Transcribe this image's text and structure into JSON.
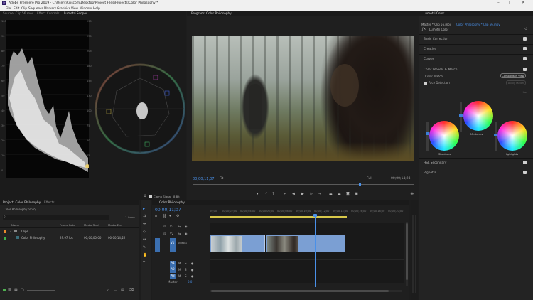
{
  "window": {
    "title": "Adobe Premiere Pro 2019 - C:\\Users\\Criscom\\Desktop\\Project Files\\Projects\\Color Philosophy *",
    "controls": [
      "–",
      "□",
      "✕"
    ]
  },
  "menu": [
    "File",
    "Edit",
    "Clip",
    "Sequence",
    "Markers",
    "Graphics",
    "View",
    "Window",
    "Help"
  ],
  "source_tabs": [
    "Source: Clip 56.mov",
    "Effect Controls",
    "Lumetri Scopes"
  ],
  "scopes": {
    "waveform_ticks_left": [
      "100",
      "90",
      "80",
      "70",
      "60",
      "50",
      "40",
      "30",
      "20",
      "10",
      "0"
    ],
    "waveform_ticks_right": [
      "255",
      "230",
      "205",
      "180",
      "155",
      "130",
      "100",
      "75",
      "50",
      "25",
      "0"
    ],
    "clamp_label": "Clamp Signal",
    "bit_label": "8 Bit"
  },
  "program": {
    "tab": "Program: Color Philosophy",
    "timecode": "00;00;11;07",
    "fit": "Fit",
    "full": "Full",
    "duration": "00;00;14;23"
  },
  "lumetri": {
    "tab": "Lumetri Color",
    "master": "Master * Clip 56.mov",
    "sequence": "Color Philosophy * Clip 56.mov",
    "effect": "Lumetri Color",
    "sections": [
      {
        "label": "Basic Correction"
      },
      {
        "label": "Creative"
      },
      {
        "label": "Curves"
      },
      {
        "label": "Color Wheels & Match"
      }
    ],
    "color_match": "Color Match",
    "comparison_view": "Comparison View",
    "face_detection": "Face Detection",
    "apply_match": "Apply Match",
    "hue_label": "Hue",
    "shadows": "Shadows",
    "midtones": "Midtones",
    "highlights": "Highlights",
    "hsl": "HSL Secondary",
    "vignette": "Vignette"
  },
  "project": {
    "tabs": [
      "Project: Color Philosophy",
      "Effects"
    ],
    "path": "Color Philosophy.prproj",
    "item_count": "1 Items",
    "columns": [
      "Name",
      "Frame Rate",
      "Media Start",
      "Media End"
    ],
    "rows": [
      {
        "name": "Clips",
        "rate": "",
        "start": "",
        "end": "",
        "color": "#e88a2c"
      },
      {
        "name": "Color Philosophy",
        "rate": "29.97 fps",
        "start": "00;00;00;00",
        "end": "00;00;14;22",
        "color": "#3cb44a"
      }
    ]
  },
  "timeline": {
    "tab": "Color Philosophy",
    "timecode": "00;00;11;07",
    "ruler": [
      "00;00",
      "00;00;02;00",
      "00;00;04;00",
      "00;00;06;00",
      "00;00;08;00",
      "00;00;10;00",
      "00;00;12;00",
      "00;00;14;00",
      "00;00;16;00",
      "00;00;18;00",
      "00;00;20;00",
      "00;00;22;00"
    ],
    "video_tracks": [
      "V3",
      "V2",
      "V1"
    ],
    "audio_tracks": [
      "A1",
      "A2",
      "A3"
    ],
    "video_label": "Video 1",
    "master": "Master",
    "master_val": "0.0",
    "playhead_fraction": 0.54
  }
}
